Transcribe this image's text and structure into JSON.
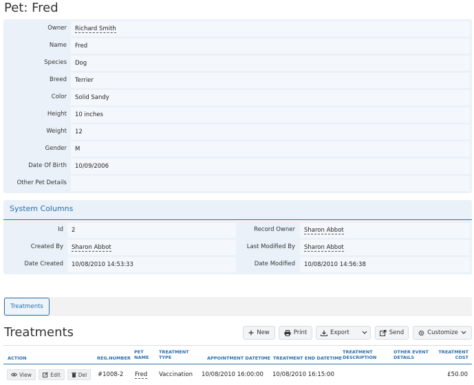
{
  "page_title": "Pet: Fred",
  "pet_details": [
    {
      "label": "Owner",
      "value": "Richard Smith",
      "link": true
    },
    {
      "label": "Name",
      "value": "Fred",
      "link": false
    },
    {
      "label": "Species",
      "value": "Dog",
      "link": false
    },
    {
      "label": "Breed",
      "value": "Terrier",
      "link": false
    },
    {
      "label": "Color",
      "value": "Solid Sandy",
      "link": false
    },
    {
      "label": "Height",
      "value": "10 inches",
      "link": false
    },
    {
      "label": "Weight",
      "value": "12",
      "link": false
    },
    {
      "label": "Gender",
      "value": "M",
      "link": false
    },
    {
      "label": "Date Of Birth",
      "value": "10/09/2006",
      "link": false
    },
    {
      "label": "Other Pet Details",
      "value": "",
      "link": false
    }
  ],
  "system_columns": {
    "title": "System Columns",
    "rows": [
      {
        "left_label": "Id",
        "left_value": "2",
        "right_label": "Record Owner",
        "right_value": "Sharon Abbot"
      },
      {
        "left_label": "Created By",
        "left_value": "Sharon Abbot",
        "right_label": "Last Modified By",
        "right_value": "Sharon Abbot"
      },
      {
        "left_label": "Date Created",
        "left_value": "10/08/2010 14:53:33",
        "right_label": "Date Modified",
        "right_value": "10/08/2010 14:56:38"
      }
    ]
  },
  "tabs": [
    {
      "label": "Treatments",
      "active": true
    }
  ],
  "treatments": {
    "title": "Treatments",
    "toolbar": {
      "new_label": "New",
      "print_label": "Print",
      "export_label": "Export",
      "send_label": "Send",
      "customize_label": "Customize"
    },
    "columns": [
      "Action",
      "Reg.Number",
      "Pet Name",
      "Treatment Type",
      "Appointment Datetime",
      "Treatment End Datetime",
      "Treatment Description",
      "Other Event Details",
      "Treatment Cost"
    ],
    "rows": [
      {
        "actions": {
          "view": "View",
          "edit": "Edit",
          "del": "Del"
        },
        "reg_number": "#1008-2",
        "pet_name": "Fred",
        "treatment_type": "Vaccination",
        "appointment_datetime": "10/08/2010 16:00:00",
        "treatment_end_datetime": "10/08/2010 16:15:00",
        "treatment_description": "",
        "other_event_details": "",
        "treatment_cost": "£50.00"
      }
    ]
  },
  "colors": {
    "accent": "#2a6ead",
    "panel_bg": "#eaf1f8",
    "field_bg": "#f4f8fc"
  },
  "icons": [
    "pencil-icon",
    "plus-icon",
    "printer-icon",
    "download-icon",
    "chevron-down-icon",
    "share-icon",
    "gear-icon",
    "eye-icon",
    "edit-icon",
    "trash-icon"
  ]
}
